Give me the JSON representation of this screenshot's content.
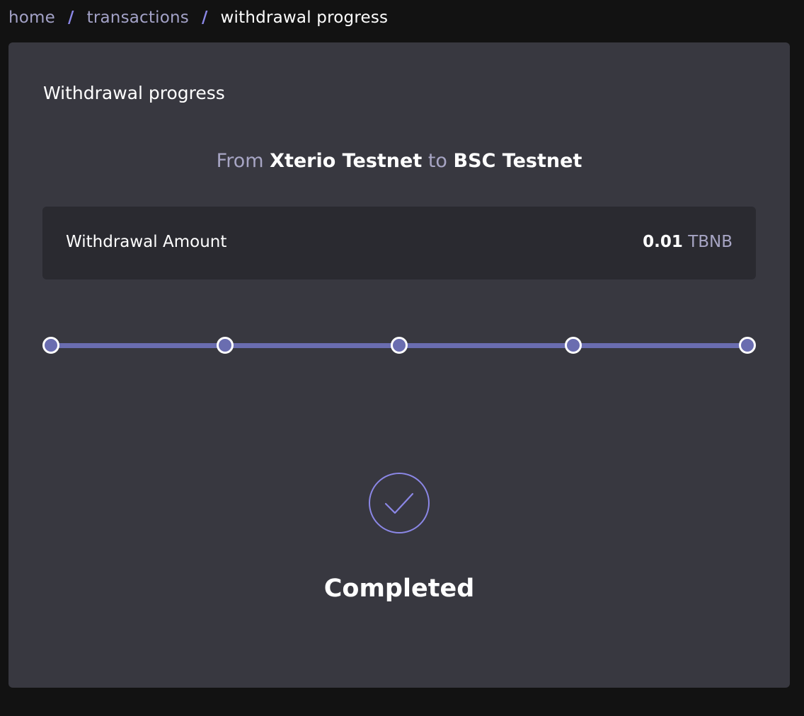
{
  "breadcrumb": {
    "home": "home",
    "transactions": "transactions",
    "current": "withdrawal progress",
    "separator": "/"
  },
  "card": {
    "title": "Withdrawal progress"
  },
  "route": {
    "from_label": "From",
    "from_network": "Xterio Testnet",
    "to_label": "to",
    "to_network": "BSC Testnet"
  },
  "amount": {
    "label": "Withdrawal Amount",
    "value": "0.01",
    "unit": "TBNB"
  },
  "progress": {
    "steps_total": 5,
    "steps_completed": 5,
    "completed_fraction": 1.0
  },
  "status": {
    "icon": "checkmark-circle-icon",
    "text": "Completed"
  },
  "colors": {
    "page_background": "#121212",
    "card_background": "#383840",
    "amount_background": "#2a2a30",
    "accent": "#6a6db0",
    "accent_light": "#8b87e6",
    "muted_text": "#a7a5c4",
    "text": "#ffffff"
  }
}
